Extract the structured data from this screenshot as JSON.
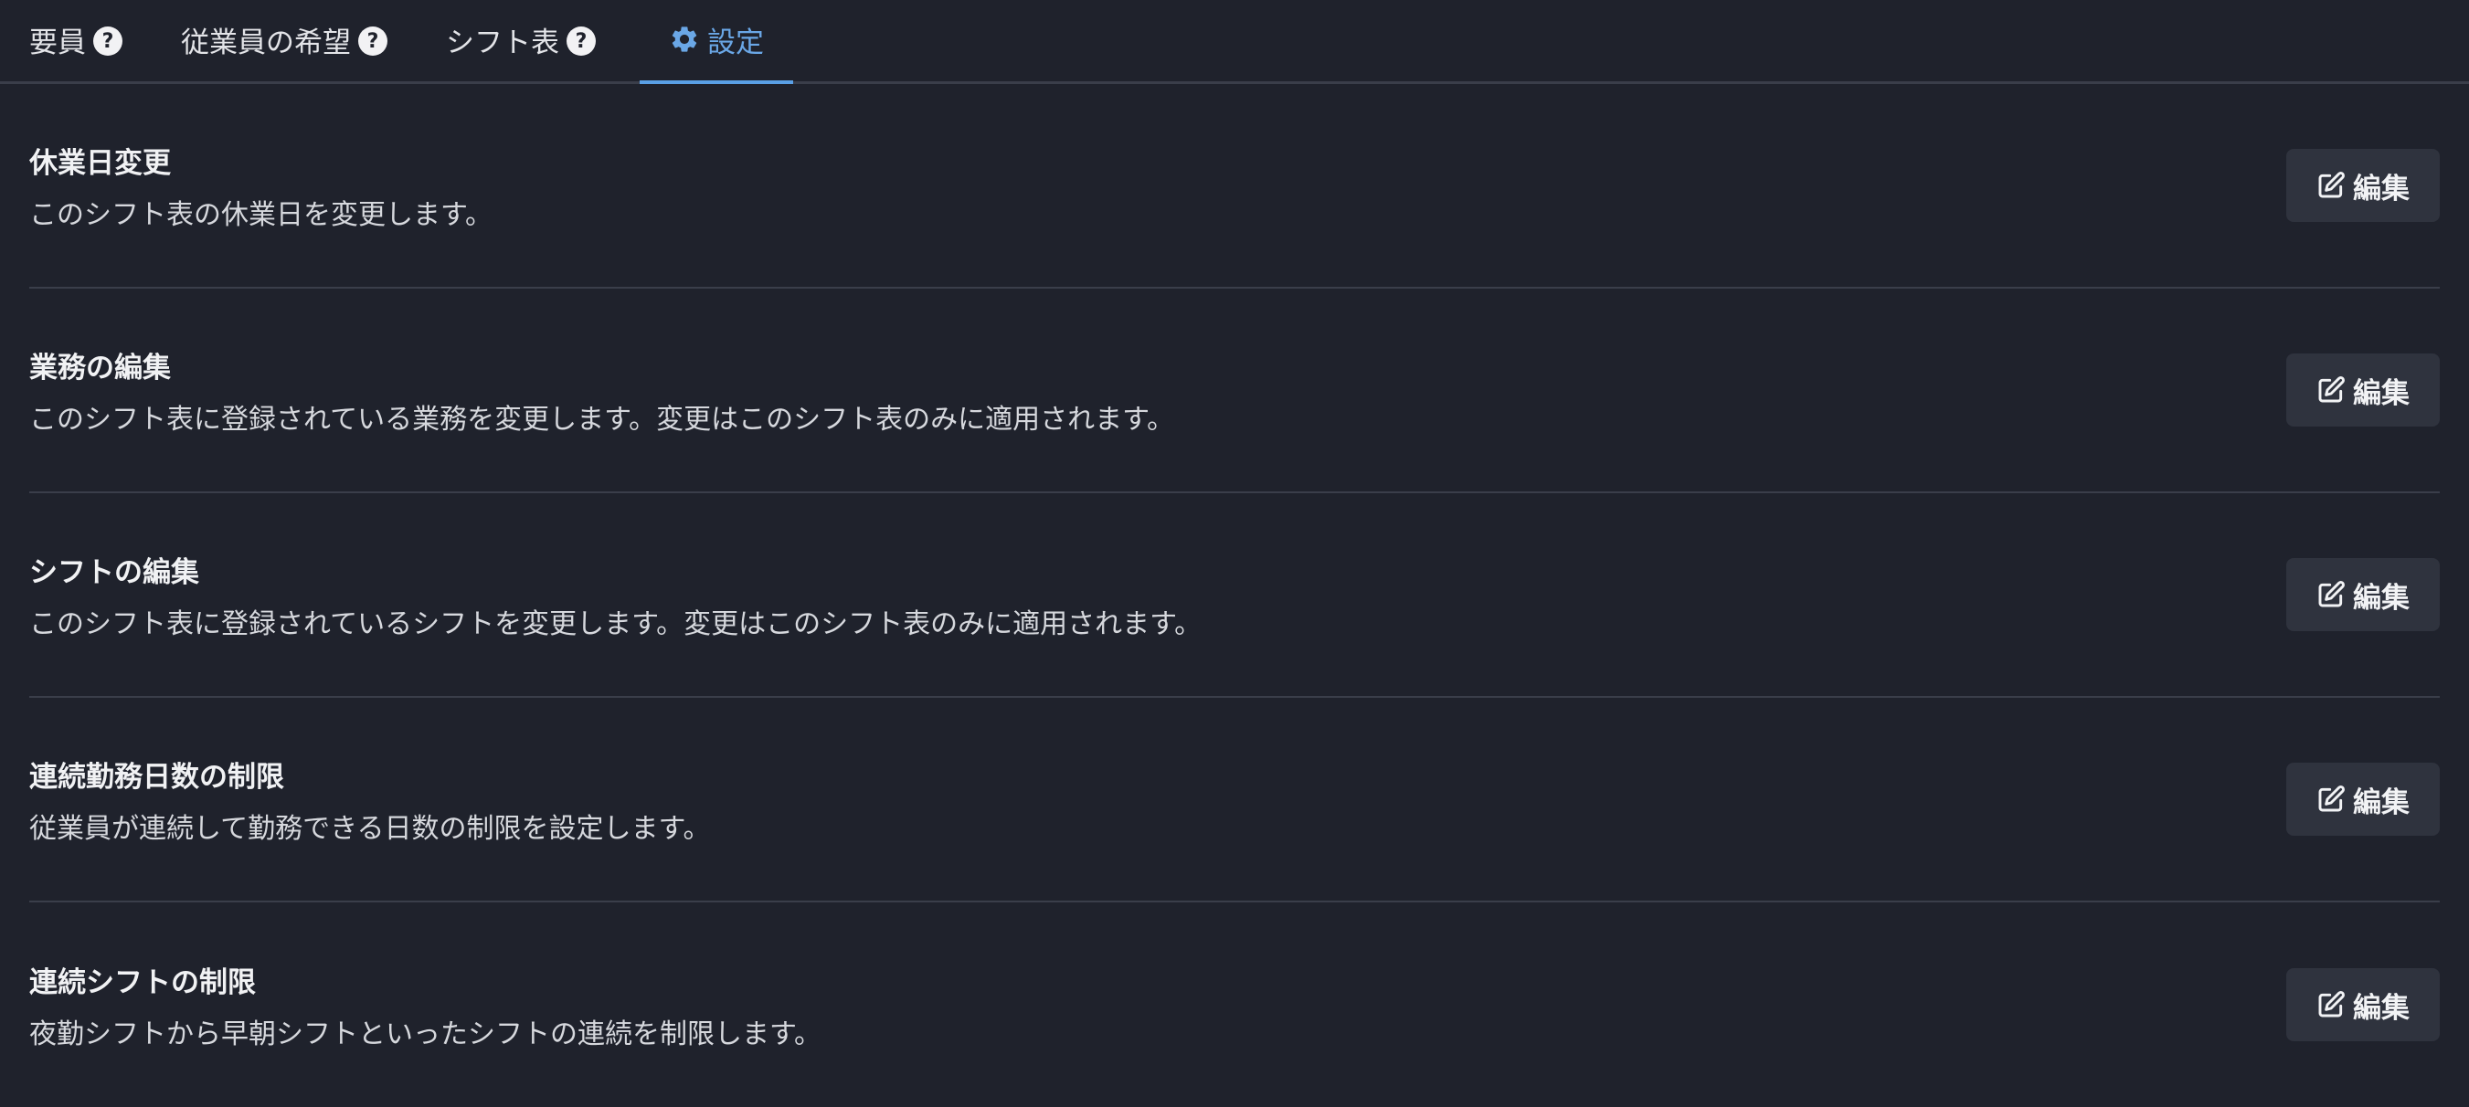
{
  "tabs": [
    {
      "label": "要員",
      "help": "?"
    },
    {
      "label": "従業員の希望",
      "help": "?"
    },
    {
      "label": "シフト表",
      "help": "?"
    },
    {
      "label": "設定"
    }
  ],
  "settings": [
    {
      "title": "休業日変更",
      "description": "このシフト表の休業日を変更します。",
      "button": "編集"
    },
    {
      "title": "業務の編集",
      "description": "このシフト表に登録されている業務を変更します。変更はこのシフト表のみに適用されます。",
      "button": "編集"
    },
    {
      "title": "シフトの編集",
      "description": "このシフト表に登録されているシフトを変更します。変更はこのシフト表のみに適用されます。",
      "button": "編集"
    },
    {
      "title": "連続勤務日数の制限",
      "description": "従業員が連続して勤務できる日数の制限を設定します。",
      "button": "編集"
    },
    {
      "title": "連続シフトの制限",
      "description": "夜勤シフトから早朝シフトといったシフトの連続を制限します。",
      "button": "編集"
    }
  ],
  "colors": {
    "background": "#1f222c",
    "accent": "#5aa0e6",
    "button": "#2f333e",
    "divider": "#3a3e4a"
  }
}
